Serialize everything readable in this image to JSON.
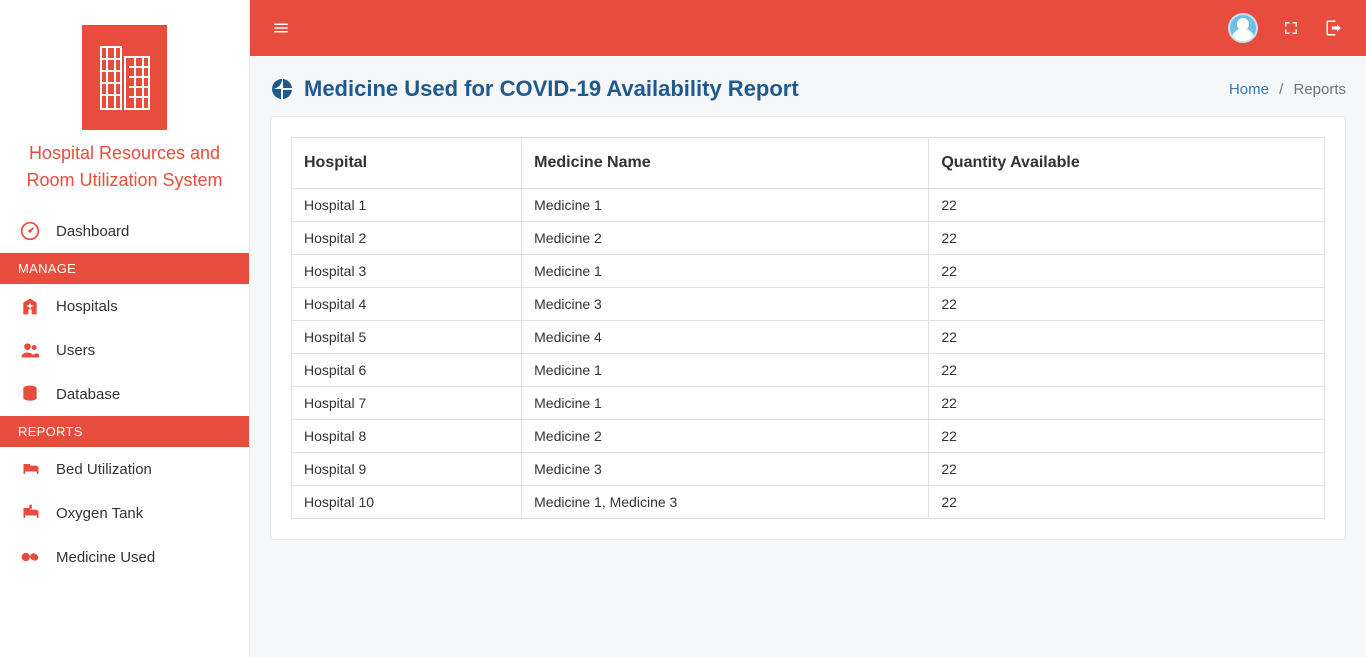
{
  "brand": {
    "line1": "Hospital Resources and",
    "line2": "Room Utilization System"
  },
  "sidebar": {
    "dashboard": "Dashboard",
    "headers": {
      "manage": "MANAGE",
      "reports": "REPORTS"
    },
    "manage": {
      "hospitals": "Hospitals",
      "users": "Users",
      "database": "Database"
    },
    "reports": {
      "bed": "Bed Utilization",
      "oxygen": "Oxygen Tank",
      "medicine": "Medicine Used"
    }
  },
  "page": {
    "title": "Medicine Used for COVID-19 Availability Report"
  },
  "breadcrumb": {
    "home": "Home",
    "current": "Reports"
  },
  "table": {
    "headers": {
      "hospital": "Hospital",
      "medicine": "Medicine Name",
      "qty": "Quantity Available"
    },
    "rows": [
      {
        "hospital": "Hospital 1",
        "medicine": "Medicine 1",
        "qty": "22"
      },
      {
        "hospital": "Hospital 2",
        "medicine": "Medicine 2",
        "qty": "22"
      },
      {
        "hospital": "Hospital 3",
        "medicine": "Medicine 1",
        "qty": "22"
      },
      {
        "hospital": "Hospital 4",
        "medicine": "Medicine 3",
        "qty": "22"
      },
      {
        "hospital": "Hospital 5",
        "medicine": "Medicine 4",
        "qty": "22"
      },
      {
        "hospital": "Hospital 6",
        "medicine": "Medicine 1",
        "qty": "22"
      },
      {
        "hospital": "Hospital 7",
        "medicine": "Medicine 1",
        "qty": "22"
      },
      {
        "hospital": "Hospital 8",
        "medicine": "Medicine 2",
        "qty": "22"
      },
      {
        "hospital": "Hospital 9",
        "medicine": "Medicine 3",
        "qty": "22"
      },
      {
        "hospital": "Hospital 10",
        "medicine": "Medicine 1, Medicine 3",
        "qty": "22"
      }
    ]
  }
}
